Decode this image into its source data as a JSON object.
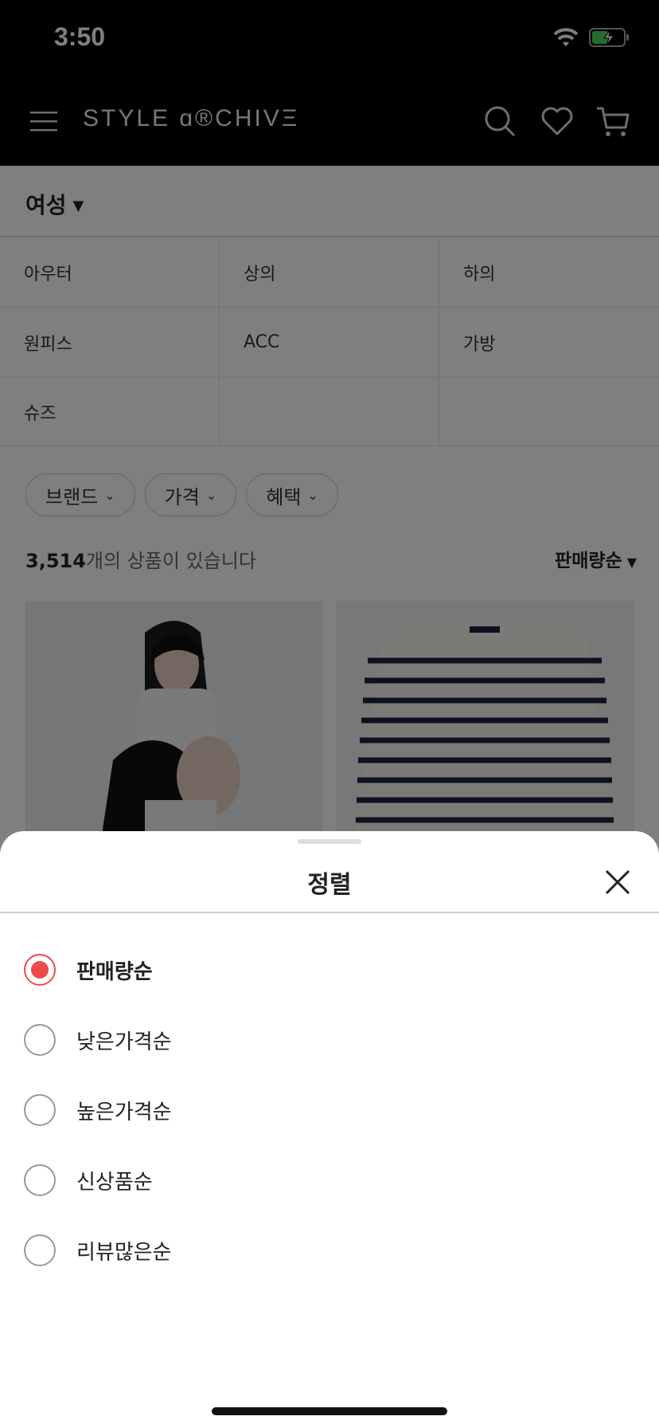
{
  "status_bar": {
    "time": "3:50"
  },
  "header": {
    "logo": "STYLE ɑ®CHIVΞ",
    "icons": [
      "menu-icon",
      "search-icon",
      "heart-icon",
      "cart-icon"
    ]
  },
  "gender_selector": {
    "label": "여성"
  },
  "categories": [
    "아우터",
    "상의",
    "하의",
    "원피스",
    "ACC",
    "가방",
    "슈즈",
    "",
    ""
  ],
  "filters": [
    {
      "label": "브랜드"
    },
    {
      "label": "가격"
    },
    {
      "label": "혜택"
    }
  ],
  "results": {
    "count": "3,514",
    "suffix": "개의 상품이 있습니다",
    "sort_label": "판매량순"
  },
  "sort_sheet": {
    "title": "정렬",
    "options": [
      {
        "label": "판매량순",
        "selected": true
      },
      {
        "label": "낮은가격순",
        "selected": false
      },
      {
        "label": "높은가격순",
        "selected": false
      },
      {
        "label": "신상품순",
        "selected": false
      },
      {
        "label": "리뷰많은순",
        "selected": false
      }
    ]
  },
  "colors": {
    "accent": "#ee4a4a",
    "header_bg": "#000000"
  }
}
